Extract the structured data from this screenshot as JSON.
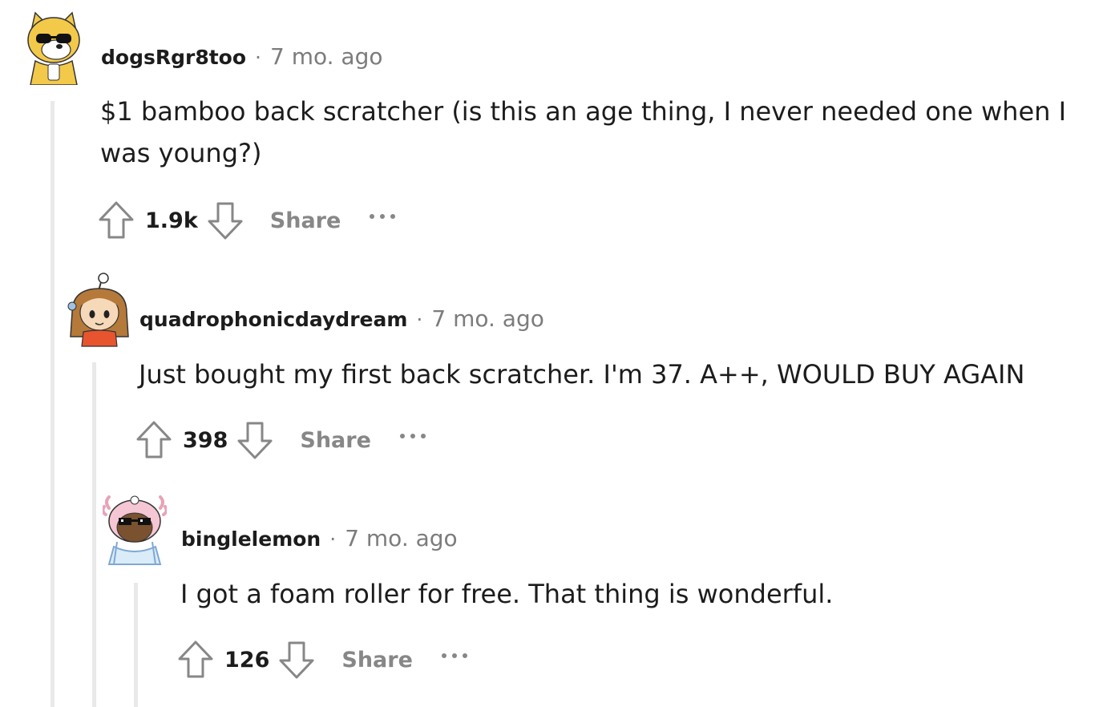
{
  "comments": [
    {
      "username": "dogsRgr8too",
      "separator": "·",
      "time": "7 mo. ago",
      "body": "$1 bamboo back scratcher (is this an age thing, I never needed one when I was young?)",
      "votes": "1.9k",
      "share_label": "Share",
      "avatar_icon": "shiba-sunglasses-avatar-icon"
    },
    {
      "username": "quadrophonicdaydream",
      "separator": "·",
      "time": "7 mo. ago",
      "body": "Just bought my first back scratcher. I'm 37. A++, WOULD BUY AGAIN",
      "votes": "398",
      "share_label": "Share",
      "avatar_icon": "brown-hair-antenna-avatar-icon"
    },
    {
      "username": "binglelemon",
      "separator": "·",
      "time": "7 mo. ago",
      "body": "I got a foam roller for free. That thing is wonderful.",
      "votes": "126",
      "share_label": "Share",
      "avatar_icon": "axolotl-pixel-sunglasses-avatar-icon"
    }
  ],
  "colors": {
    "text": "#1c1c1c",
    "meta": "#7c7c7c",
    "action_gray": "#878787",
    "thread_line": "#e9e9e9"
  }
}
